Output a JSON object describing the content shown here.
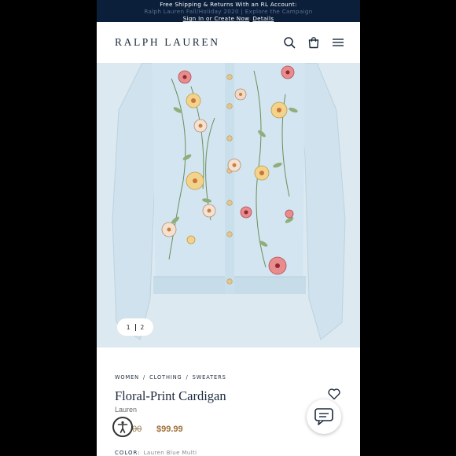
{
  "promo": {
    "line1": "Free Shipping & Returns With an RL Account:",
    "line2": "Ralph Lauren Fall/Holiday 2020 | Explore the Campaign",
    "signin_label": "Sign In or Create Now",
    "details_label": "Details"
  },
  "header": {
    "logo": "RALPH LAUREN",
    "icons": [
      "search-icon",
      "shopping-bag-icon",
      "menu-icon"
    ]
  },
  "gallery": {
    "current": "1",
    "total": "2"
  },
  "product": {
    "breadcrumbs": [
      "WOMEN",
      "CLOTHING",
      "SWEATERS"
    ],
    "title": "Floral-Print Cardigan",
    "brand": "Lauren",
    "original_price": "00",
    "sale_price": "$99.99",
    "color_label": "COLOR:",
    "color_value": "Lauren Blue Multi"
  },
  "colors": {
    "banner_bg": "#0b1f3a",
    "navy_text": "#1b2a3d",
    "sale_price": "#a0703a",
    "cardigan_blue": "#cfe3ee"
  }
}
